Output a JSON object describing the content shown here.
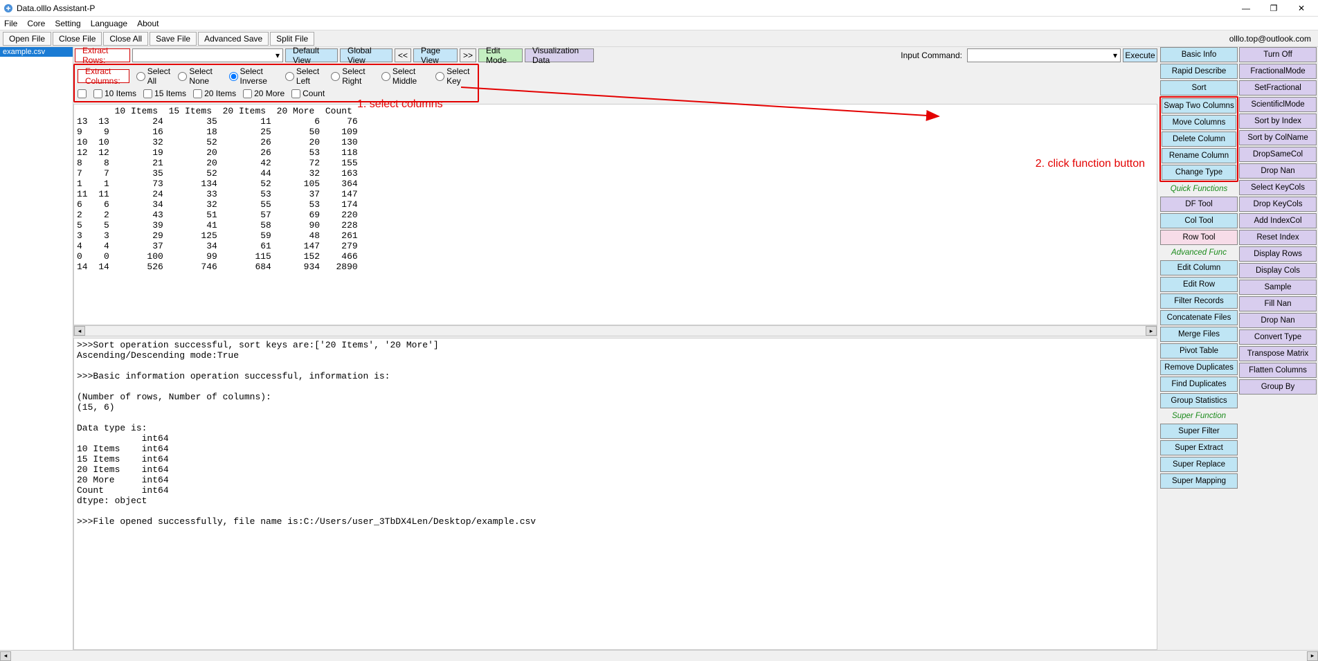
{
  "window": {
    "title": "Data.olllo Assistant-P",
    "win_min": "—",
    "win_max": "❐",
    "win_close": "✕"
  },
  "menubar": [
    "File",
    "Core",
    "Setting",
    "Language",
    "About"
  ],
  "toolbar1": {
    "btns": [
      "Open File",
      "Close File",
      "Close All",
      "Save File",
      "Advanced Save",
      "Split File"
    ],
    "email": "olllo.top@outlook.com"
  },
  "filelist": {
    "file0": "example.csv"
  },
  "toolbar2": {
    "extract_rows": "Extract Rows:",
    "default_view": "Default View",
    "global_view": "Global View",
    "prev": "<<",
    "page_view": "Page View",
    "next": ">>",
    "edit_mode": "Edit Mode",
    "viz": "Visualization Data",
    "input_cmd": "Input Command:",
    "execute": "Execute"
  },
  "toolbar3": {
    "extract_cols": "Extract Columns:",
    "radios": [
      "Select All",
      "Select None",
      "Select Inverse",
      "Select Left",
      "Select Right",
      "Select Middle",
      "Select Key"
    ],
    "selected_radio": 2,
    "checks": [
      "10 Items",
      "15 Items",
      "20 Items",
      "20 More",
      "Count"
    ]
  },
  "annotations": {
    "step1": "1. select columns",
    "step2": "2. click function button"
  },
  "data_header": "       10 Items  15 Items  20 Items  20 More  Count",
  "data_rows": [
    "13  13        24        35        11        6     76",
    "9    9        16        18        25       50    109",
    "10  10        32        52        26       20    130",
    "12  12        19        20        26       53    118",
    "8    8        21        20        42       72    155",
    "7    7        35        52        44       32    163",
    "1    1        73       134        52      105    364",
    "11  11        24        33        53       37    147",
    "6    6        34        32        55       53    174",
    "2    2        43        51        57       69    220",
    "5    5        39        41        58       90    228",
    "3    3        29       125        59       48    261",
    "4    4        37        34        61      147    279",
    "0    0       100        99       115      152    466",
    "14  14       526       746       684      934   2890"
  ],
  "log_lines": [
    ">>>Sort operation successful, sort keys are:['20 Items', '20 More']",
    "Ascending/Descending mode:True",
    "",
    ">>>Basic information operation successful, information is:",
    "",
    "(Number of rows, Number of columns):",
    "(15, 6)",
    "",
    "Data type is:",
    "            int64",
    "10 Items    int64",
    "15 Items    int64",
    "20 Items    int64",
    "20 More     int64",
    "Count       int64",
    "dtype: object",
    "",
    ">>>File opened successfully, file name is:C:/Users/user_3TbDX4Len/Desktop/example.csv"
  ],
  "right": {
    "col1": [
      {
        "t": "Basic Info",
        "c": "blue"
      },
      {
        "t": "Rapid Describe",
        "c": "blue"
      },
      {
        "t": "Sort",
        "c": "blue"
      },
      {
        "t": "Swap Two Columns",
        "c": "blue",
        "boxstart": true
      },
      {
        "t": "Move Columns",
        "c": "blue"
      },
      {
        "t": "Delete Column",
        "c": "blue"
      },
      {
        "t": "Rename Column",
        "c": "blue"
      },
      {
        "t": "Change Type",
        "c": "blue",
        "boxend": true
      },
      {
        "t": "Quick Functions",
        "c": "head"
      },
      {
        "t": "DF Tool",
        "c": "lav"
      },
      {
        "t": "Col Tool",
        "c": "blue"
      },
      {
        "t": "Row Tool",
        "c": "pink"
      },
      {
        "t": "Advanced Func",
        "c": "head"
      },
      {
        "t": "Edit Column",
        "c": "blue"
      },
      {
        "t": "Edit Row",
        "c": "blue"
      },
      {
        "t": "Filter Records",
        "c": "blue"
      },
      {
        "t": "Concatenate Files",
        "c": "blue"
      },
      {
        "t": "Merge Files",
        "c": "blue"
      },
      {
        "t": "Pivot Table",
        "c": "blue"
      },
      {
        "t": "Remove Duplicates",
        "c": "blue"
      },
      {
        "t": "Find Duplicates",
        "c": "blue"
      },
      {
        "t": "Group Statistics",
        "c": "blue"
      },
      {
        "t": "Super Function",
        "c": "head"
      },
      {
        "t": "Super Filter",
        "c": "blue"
      },
      {
        "t": "Super Extract",
        "c": "blue"
      },
      {
        "t": "Super Replace",
        "c": "blue"
      },
      {
        "t": "Super Mapping",
        "c": "blue"
      }
    ],
    "col2": [
      {
        "t": "Turn Off",
        "c": "lav"
      },
      {
        "t": "FractionalMode",
        "c": "lav"
      },
      {
        "t": "SetFractional",
        "c": "lav"
      },
      {
        "t": "ScientificlMode",
        "c": "lav"
      },
      {
        "t": "Sort by Index",
        "c": "lav"
      },
      {
        "t": "Sort by ColName",
        "c": "lav"
      },
      {
        "t": "DropSameCol",
        "c": "lav"
      },
      {
        "t": "Drop Nan",
        "c": "lav"
      },
      {
        "t": "Select KeyCols",
        "c": "lav"
      },
      {
        "t": "Drop KeyCols",
        "c": "lav"
      },
      {
        "t": "Add IndexCol",
        "c": "lav"
      },
      {
        "t": "Reset Index",
        "c": "lav"
      },
      {
        "t": "Display Rows",
        "c": "lav"
      },
      {
        "t": "Display Cols",
        "c": "lav"
      },
      {
        "t": "Sample",
        "c": "lav"
      },
      {
        "t": "Fill Nan",
        "c": "lav"
      },
      {
        "t": "Drop Nan",
        "c": "lav"
      },
      {
        "t": "Convert Type",
        "c": "lav"
      },
      {
        "t": "Transpose Matrix",
        "c": "lav"
      },
      {
        "t": "Flatten Columns",
        "c": "lav"
      },
      {
        "t": "Group By",
        "c": "lav"
      }
    ]
  }
}
